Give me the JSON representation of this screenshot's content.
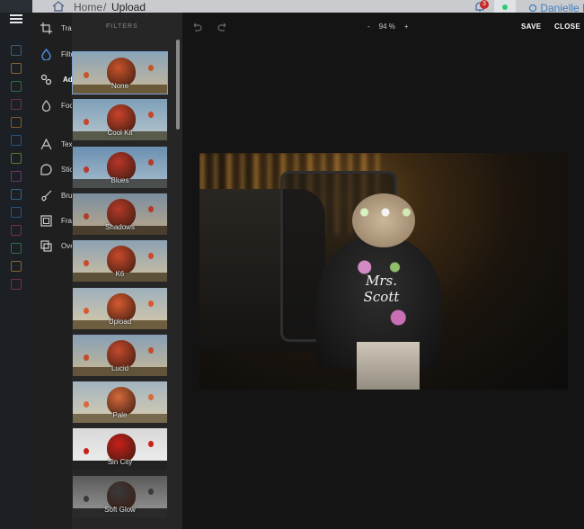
{
  "topbar": {
    "breadcrumb_home": "Home",
    "breadcrumb_sep": "/",
    "breadcrumb_current": "Upload",
    "notification_count": "3",
    "user_name": "Danielle F"
  },
  "tools": {
    "items": [
      {
        "label": "Transform",
        "icon": "transform-icon"
      },
      {
        "label": "Filters",
        "icon": "filters-icon"
      },
      {
        "label": "Adjust",
        "icon": "adjust-icon"
      },
      {
        "label": "Focus",
        "icon": "focus-icon"
      },
      {
        "label": "Text",
        "icon": "text-icon"
      },
      {
        "label": "Stickers",
        "icon": "stickers-icon"
      },
      {
        "label": "Brush",
        "icon": "brush-icon"
      },
      {
        "label": "Frames",
        "icon": "frames-icon"
      },
      {
        "label": "Overlays",
        "icon": "overlays-icon"
      }
    ],
    "active": "Adjust"
  },
  "filters": {
    "title": "FILTERS",
    "items": [
      {
        "label": "None"
      },
      {
        "label": "Cool Kit"
      },
      {
        "label": "Blues"
      },
      {
        "label": "Shadows"
      },
      {
        "label": "K6"
      },
      {
        "label": "Upload"
      },
      {
        "label": "Lucid"
      },
      {
        "label": "Pale"
      },
      {
        "label": "Sin City"
      },
      {
        "label": "Soft Glow"
      }
    ],
    "selected": "None"
  },
  "toolbar": {
    "zoom_minus": "-",
    "zoom_value": "94 %",
    "zoom_plus": "+",
    "save_label": "SAVE",
    "close_label": "CLOSE"
  },
  "photo": {
    "painted_text_line1": "Mrs.",
    "painted_text_line2": "Scott"
  },
  "colors": {
    "accent": "#7fa3d6",
    "panel": "#262626",
    "canvas": "#141414",
    "badge": "#c62828"
  }
}
